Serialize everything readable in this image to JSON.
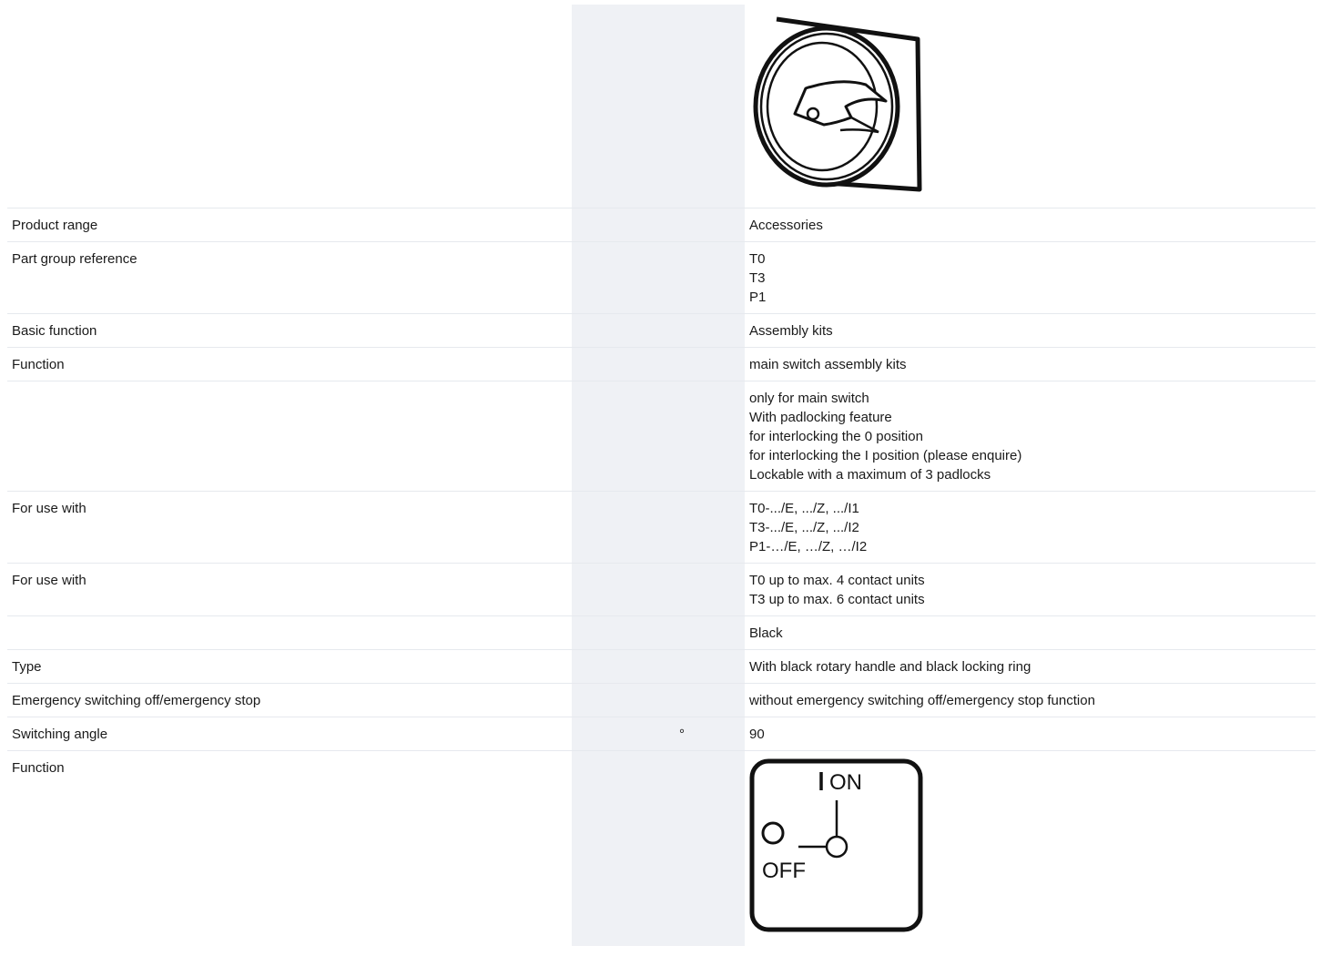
{
  "rows": {
    "product_range": {
      "label": "Product range",
      "unit": "",
      "value": "Accessories"
    },
    "part_group_reference": {
      "label": "Part group reference",
      "unit": "",
      "values": [
        "T0",
        "T3",
        "P1"
      ]
    },
    "basic_function": {
      "label": "Basic function",
      "unit": "",
      "value": "Assembly kits"
    },
    "function_1": {
      "label": "Function",
      "unit": "",
      "value": "main switch assembly kits"
    },
    "features": {
      "label": "",
      "unit": "",
      "values": [
        "only for main switch",
        "With padlocking feature",
        "for interlocking the 0 position",
        "for interlocking the I position (please enquire)",
        "Lockable with a maximum of 3 padlocks"
      ]
    },
    "for_use_with_1": {
      "label": "For use with",
      "unit": "",
      "values": [
        "T0-.../E, .../Z, .../I1",
        "T3-.../E, .../Z, .../I2",
        "P1-…/E, …/Z, …/I2"
      ]
    },
    "for_use_with_2": {
      "label": "For use with",
      "unit": "",
      "values": [
        "T0 up to max. 4 contact units",
        "T3 up to max. 6 contact units"
      ]
    },
    "color": {
      "label": "",
      "unit": "",
      "value": "Black"
    },
    "type": {
      "label": "Type",
      "unit": "",
      "value": "With black rotary handle and black locking ring"
    },
    "emergency": {
      "label": "Emergency switching off/emergency stop",
      "unit": "",
      "value": "without emergency switching off/emergency stop function"
    },
    "switching_angle": {
      "label": "Switching angle",
      "unit": "°",
      "value": "90"
    },
    "function_2": {
      "label": "Function",
      "unit": "",
      "diagram": {
        "on_label": "ON",
        "off_label": "OFF"
      }
    }
  },
  "product_image": {
    "icon": "rotary-handle-icon"
  }
}
